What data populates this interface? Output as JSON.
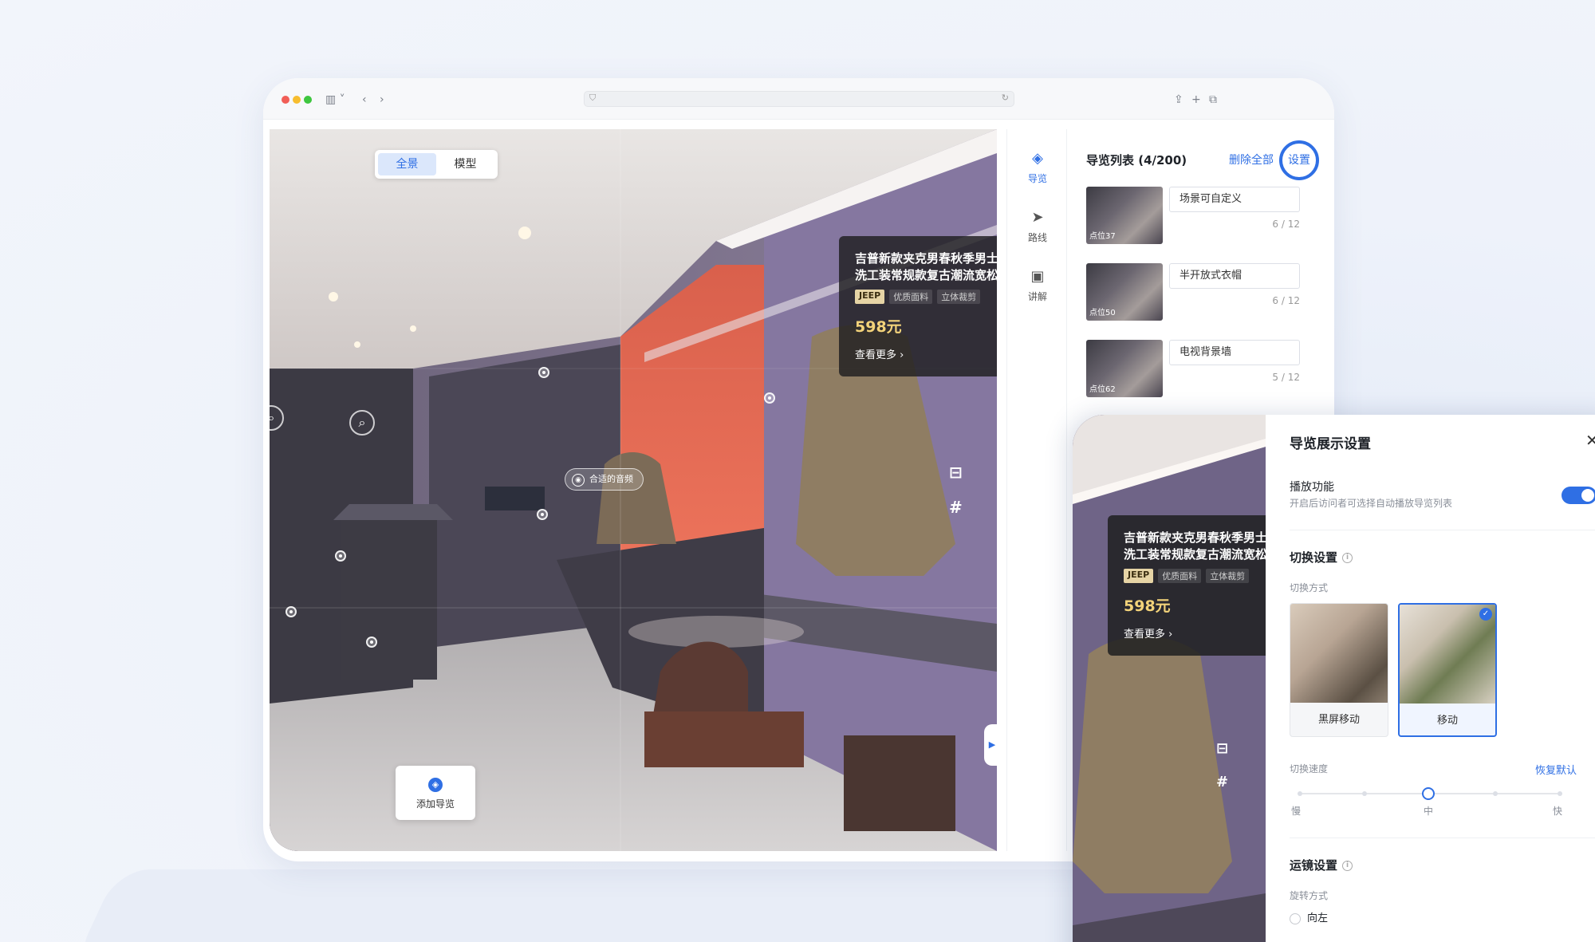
{
  "viewer": {
    "toggle": {
      "panorama": "全景",
      "model": "模型"
    },
    "product": {
      "title_line1": "吉普新款夹克男春秋季男士",
      "title_line2": "洗工装常规款复古潮流宽松",
      "tag_brand": "JEEP",
      "tag_1": "优质面料",
      "tag_2": "立体裁剪",
      "price": "598元",
      "more": "查看更多 ›"
    },
    "audio_label": "合适的音频",
    "add_tour": "添加导览"
  },
  "rail": [
    {
      "label": "导览",
      "icon": "compass-icon"
    },
    {
      "label": "路线",
      "icon": "send-icon"
    },
    {
      "label": "讲解",
      "icon": "video-icon"
    }
  ],
  "tour_list": {
    "title": "导览列表 (4/200)",
    "delete_all": "删除全部",
    "settings": "设置",
    "items": [
      {
        "thumb": "点位37",
        "name": "场景可自定义",
        "count": "6 / 12"
      },
      {
        "thumb": "点位50",
        "name": "半开放式衣帽",
        "count": "6 / 12"
      },
      {
        "thumb": "点位62",
        "name": "电视背景墙",
        "count": "5 / 12"
      }
    ]
  },
  "settings": {
    "title": "导览展示设置",
    "play_label": "播放功能",
    "play_desc": "开启后访问者可选择自动播放导览列表",
    "play_enabled": true,
    "switch_title": "切换设置",
    "switch_mode_label": "切换方式",
    "modes": [
      {
        "label": "黑屏移动",
        "selected": false
      },
      {
        "label": "移动",
        "selected": true
      }
    ],
    "speed_label": "切换速度",
    "restore": "恢复默认",
    "speed_slow": "慢",
    "speed_mid": "中",
    "speed_fast": "快",
    "speed_value": 0.5,
    "camera_title": "运镜设置",
    "rotate_label": "旋转方式",
    "rotate_option": "向左"
  },
  "colors": {
    "accent": "#2f6fe4",
    "price": "#f3d37a"
  }
}
